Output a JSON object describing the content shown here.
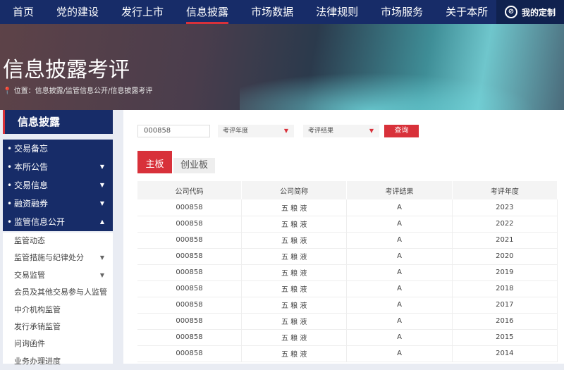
{
  "nav": {
    "items": [
      "首页",
      "党的建设",
      "发行上市",
      "信息披露",
      "市场数据",
      "法律规则",
      "市场服务",
      "关于本所"
    ],
    "active": 3,
    "custom": "我的定制"
  },
  "banner": {
    "title": "信息披露考评",
    "breadcrumb": "位置：信息披露/监管信息公开/信息披露考评"
  },
  "sidebar": {
    "title": "信息披露",
    "items": [
      {
        "label": "交易备忘",
        "caret": ""
      },
      {
        "label": "本所公告",
        "caret": "▼"
      },
      {
        "label": "交易信息",
        "caret": "▼"
      },
      {
        "label": "融资融券",
        "caret": "▼"
      },
      {
        "label": "监管信息公开",
        "caret": "▲"
      }
    ],
    "sub_items": [
      {
        "label": "监管动态",
        "caret": ""
      },
      {
        "label": "监管措施与纪律处分",
        "caret": "▼"
      },
      {
        "label": "交易监管",
        "caret": "▼"
      },
      {
        "label": "会员及其他交易参与人监管",
        "caret": ""
      },
      {
        "label": "中介机构监管",
        "caret": ""
      },
      {
        "label": "发行承销监管",
        "caret": ""
      },
      {
        "label": "问询函件",
        "caret": ""
      },
      {
        "label": "业务办理进度",
        "caret": ""
      }
    ]
  },
  "filters": {
    "code_value": "000858",
    "year_placeholder": "考评年度",
    "result_placeholder": "考评结果",
    "query": "查询"
  },
  "tabs": {
    "main": "主板",
    "gem": "创业板"
  },
  "table": {
    "headers": [
      "公司代码",
      "公司简称",
      "考评结果",
      "考评年度"
    ],
    "rows": [
      [
        "000858",
        "五 粮 液",
        "A",
        "2023"
      ],
      [
        "000858",
        "五 粮 液",
        "A",
        "2022"
      ],
      [
        "000858",
        "五 粮 液",
        "A",
        "2021"
      ],
      [
        "000858",
        "五 粮 液",
        "A",
        "2020"
      ],
      [
        "000858",
        "五 粮 液",
        "A",
        "2019"
      ],
      [
        "000858",
        "五 粮 液",
        "A",
        "2018"
      ],
      [
        "000858",
        "五 粮 液",
        "A",
        "2017"
      ],
      [
        "000858",
        "五 粮 液",
        "A",
        "2016"
      ],
      [
        "000858",
        "五 粮 液",
        "A",
        "2015"
      ],
      [
        "000858",
        "五 粮 液",
        "A",
        "2014"
      ]
    ]
  },
  "colors": {
    "navy": "#172c68",
    "accent": "#d8313a"
  }
}
